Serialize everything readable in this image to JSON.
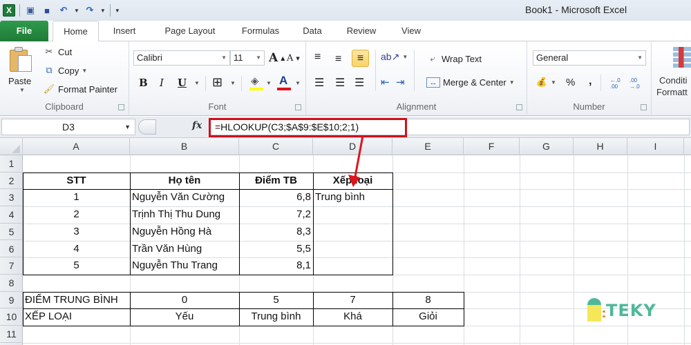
{
  "window": {
    "title": "Book1  -  Microsoft Excel",
    "app_icon": "excel-logo-icon"
  },
  "qat": {
    "items": [
      {
        "name": "save-as-icon",
        "glyph": "🖫"
      },
      {
        "name": "save-icon",
        "glyph": "💾"
      },
      {
        "name": "undo-icon",
        "glyph": "↶"
      },
      {
        "name": "redo-icon",
        "glyph": "↷"
      },
      {
        "name": "customize-qat-icon",
        "glyph": "▾"
      }
    ]
  },
  "tabs": [
    {
      "label": "File",
      "active": false
    },
    {
      "label": "Home",
      "active": true
    },
    {
      "label": "Insert",
      "active": false
    },
    {
      "label": "Page Layout",
      "active": false
    },
    {
      "label": "Formulas",
      "active": false
    },
    {
      "label": "Data",
      "active": false
    },
    {
      "label": "Review",
      "active": false
    },
    {
      "label": "View",
      "active": false
    }
  ],
  "ribbon": {
    "clipboard": {
      "label": "Clipboard",
      "paste": "Paste",
      "cut": "Cut",
      "copy": "Copy",
      "format_painter": "Format Painter"
    },
    "font": {
      "label": "Font",
      "font_name": "Calibri",
      "font_size": "11",
      "bold": "B",
      "italic": "I",
      "underline": "U",
      "grow": "A",
      "shrink": "A",
      "font_color": "A",
      "fill_color_hex": "#ffff00",
      "font_color_hex": "#e0101a"
    },
    "alignment": {
      "label": "Alignment",
      "wrap_text": "Wrap Text",
      "merge_center": "Merge & Center"
    },
    "number": {
      "label": "Number",
      "format": "General",
      "percent": "%",
      "comma": ",",
      "inc_decimal": "←.0 .00",
      "dec_decimal": ".00 →.0"
    },
    "styles": {
      "conditional_formatting_line1": "Conditi",
      "conditional_formatting_line2": "Formatt"
    }
  },
  "formula_bar": {
    "name_box": "D3",
    "fx_label": "fx",
    "formula": "=HLOOKUP(C3;$A$9:$E$10;2;1)"
  },
  "grid": {
    "columns": [
      "A",
      "B",
      "C",
      "D",
      "E",
      "F",
      "G",
      "H",
      "I"
    ],
    "rows": [
      "1",
      "2",
      "3",
      "4",
      "5",
      "6",
      "7",
      "8",
      "9",
      "10",
      "11"
    ],
    "selected_cell": "D3",
    "student_table": {
      "headers": [
        "STT",
        "Họ tên",
        "Điểm TB",
        "Xếp loại"
      ],
      "rows": [
        {
          "stt": "1",
          "name": "Nguyễn Văn Cường",
          "score": "6,8",
          "rank": "Trung bình"
        },
        {
          "stt": "2",
          "name": "Trịnh Thị Thu Dung",
          "score": "7,2",
          "rank": ""
        },
        {
          "stt": "3",
          "name": "Nguyễn Hồng Hà",
          "score": "8,3",
          "rank": ""
        },
        {
          "stt": "4",
          "name": "Trần Văn Hùng",
          "score": "5,5",
          "rank": ""
        },
        {
          "stt": "5",
          "name": "Nguyễn Thu Trang",
          "score": "8,1",
          "rank": ""
        }
      ]
    },
    "lookup_table": {
      "row9_label": "ĐIỂM TRUNG BÌNH",
      "row9_values": [
        "0",
        "5",
        "7",
        "8"
      ],
      "row10_label": "XẾP LOẠI",
      "row10_values": [
        "Yếu",
        "Trung bình",
        "Khá",
        "Giỏi"
      ]
    }
  },
  "annotations": {
    "highlight_color": "#d0101a",
    "arrow_color": "#e0141c"
  },
  "watermark": {
    "text": "TEKY",
    "color": "#4fb89a"
  }
}
